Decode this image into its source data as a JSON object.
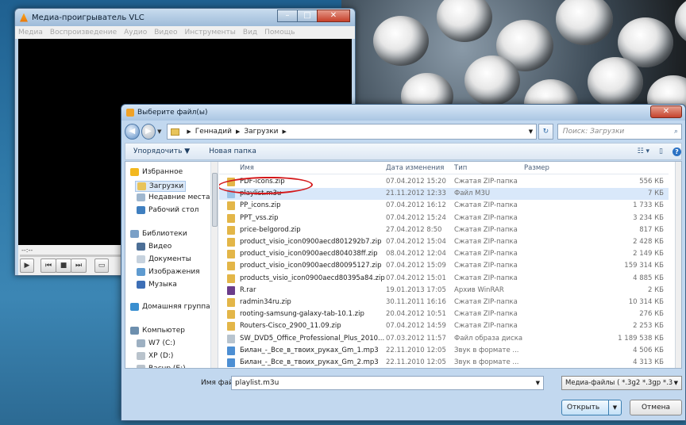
{
  "vlc": {
    "title": "Медиа-проигрыватель VLC",
    "menu": [
      "Медиа",
      "Воспроизведение",
      "Аудио",
      "Видео",
      "Инструменты",
      "Вид",
      "Помощь"
    ],
    "time_left": "--:--"
  },
  "dialog": {
    "title": "Выберите файл(ы)",
    "breadcrumb": [
      "Геннадий",
      "Загрузки"
    ],
    "search_placeholder": "Поиск: Загрузки",
    "organize_label": "Упорядочить ▼",
    "new_folder_label": "Новая папка",
    "nav": [
      {
        "label": "Избранное",
        "icon": "star-icon",
        "color": "#f3b81f"
      },
      {
        "label": "Загрузки",
        "icon": "downloads-folder-icon",
        "color": "#e8c45b",
        "selected": true
      },
      {
        "label": "Недавние места",
        "icon": "recent-places-icon",
        "color": "#9fb7cf"
      },
      {
        "label": "Рабочий стол",
        "icon": "desktop-icon",
        "color": "#3f7fc0"
      },
      {
        "label": "Библиотеки",
        "icon": "libraries-icon",
        "color": "#7aa0c7"
      },
      {
        "label": "Видео",
        "icon": "video-icon",
        "color": "#4c6f96"
      },
      {
        "label": "Документы",
        "icon": "documents-icon",
        "color": "#c6d2de"
      },
      {
        "label": "Изображения",
        "icon": "pictures-icon",
        "color": "#5f9bd0"
      },
      {
        "label": "Музыка",
        "icon": "music-icon",
        "color": "#3d6fb6"
      },
      {
        "label": "Домашняя группа",
        "icon": "homegroup-icon",
        "color": "#3a8fd0"
      },
      {
        "label": "Компьютер",
        "icon": "computer-icon",
        "color": "#6d8fae"
      },
      {
        "label": "W7 (C:)",
        "icon": "drive-icon",
        "color": "#9db0c2"
      },
      {
        "label": "XP (D:)",
        "icon": "drive-icon",
        "color": "#b9c3cc"
      },
      {
        "label": "Bacup (E:)",
        "icon": "drive-icon",
        "color": "#b9c3cc"
      }
    ],
    "columns": {
      "name": "Имя",
      "date": "Дата изменения",
      "type": "Тип",
      "size": "Размер"
    },
    "files": [
      {
        "name": "PDF-icons.zip",
        "date": "07.04.2012 15:20",
        "type": "Сжатая ZIP-папка",
        "size": "556 КБ",
        "icon": "zip-icon"
      },
      {
        "name": "playlist.m3u",
        "date": "21.11.2012 12:33",
        "type": "Файл M3U",
        "size": "7 КБ",
        "icon": "playlist-icon",
        "selected": true
      },
      {
        "name": "PP_icons.zip",
        "date": "07.04.2012 16:12",
        "type": "Сжатая ZIP-папка",
        "size": "1 733 КБ",
        "icon": "zip-icon"
      },
      {
        "name": "PPT_vss.zip",
        "date": "07.04.2012 15:24",
        "type": "Сжатая ZIP-папка",
        "size": "3 234 КБ",
        "icon": "zip-icon"
      },
      {
        "name": "price-belgorod.zip",
        "date": "27.04.2012 8:50",
        "type": "Сжатая ZIP-папка",
        "size": "817 КБ",
        "icon": "zip-icon"
      },
      {
        "name": "product_visio_icon0900aecd801292b7.zip",
        "date": "07.04.2012 15:04",
        "type": "Сжатая ZIP-папка",
        "size": "2 428 КБ",
        "icon": "zip-icon"
      },
      {
        "name": "product_visio_icon0900aecd804038ff.zip",
        "date": "08.04.2012 12:04",
        "type": "Сжатая ZIP-папка",
        "size": "2 149 КБ",
        "icon": "zip-icon"
      },
      {
        "name": "product_visio_icon0900aecd80095127.zip",
        "date": "07.04.2012 15:09",
        "type": "Сжатая ZIP-папка",
        "size": "159 314 КБ",
        "icon": "zip-icon"
      },
      {
        "name": "products_visio_icon0900aecd80395a84.zip",
        "date": "07.04.2012 15:01",
        "type": "Сжатая ZIP-папка",
        "size": "4 885 КБ",
        "icon": "zip-icon"
      },
      {
        "name": "R.rar",
        "date": "19.01.2013 17:05",
        "type": "Архив WinRAR",
        "size": "2 КБ",
        "icon": "rar-icon"
      },
      {
        "name": "radmin34ru.zip",
        "date": "30.11.2011 16:16",
        "type": "Сжатая ZIP-папка",
        "size": "10 314 КБ",
        "icon": "zip-icon"
      },
      {
        "name": "rooting-samsung-galaxy-tab-10.1.zip",
        "date": "20.04.2012 10:51",
        "type": "Сжатая ZIP-папка",
        "size": "276 КБ",
        "icon": "zip-icon"
      },
      {
        "name": "Routers-Cisco_2900_11.09.zip",
        "date": "07.04.2012 14:59",
        "type": "Сжатая ZIP-папка",
        "size": "2 253 КБ",
        "icon": "zip-icon"
      },
      {
        "name": "SW_DVD5_Office_Professional_Plus_2010...",
        "date": "07.03.2012 11:57",
        "type": "Файл образа диска",
        "size": "1 189 538 КБ",
        "icon": "disc-image-icon"
      },
      {
        "name": "Билан_-_Все_в_твоих_руках_Gm_1.mp3",
        "date": "22.11.2010 12:05",
        "type": "Звук в формате ...",
        "size": "4 506 КБ",
        "icon": "audio-file-icon"
      },
      {
        "name": "Билан_-_Все_в_твоих_руках_Gm_2.mp3",
        "date": "22.11.2010 12:05",
        "type": "Звук в формате ...",
        "size": "4 313 КБ",
        "icon": "audio-file-icon"
      }
    ],
    "filename_label": "Имя файла:",
    "filename_value": "playlist.m3u",
    "filter_value": "Медиа-файлы ( *.3g2 *.3gp *.3",
    "open_label": "Открыть",
    "cancel_label": "Отмена"
  }
}
